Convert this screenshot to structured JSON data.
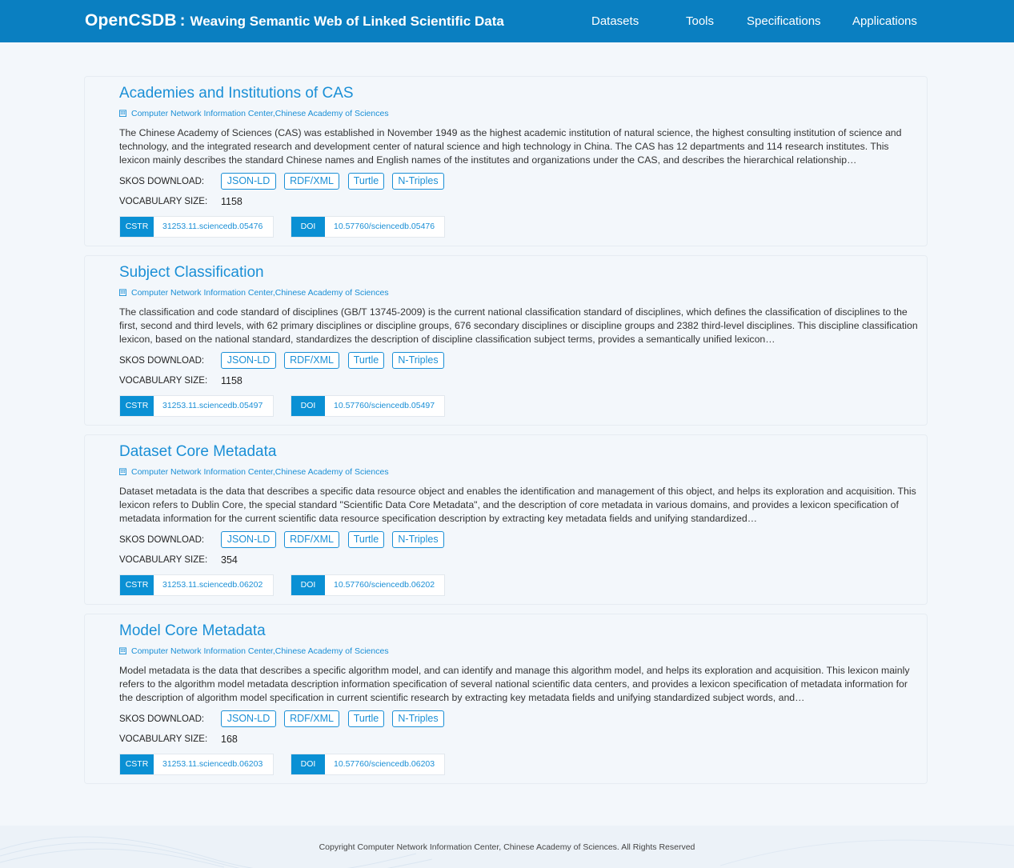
{
  "header": {
    "brand": "OpenCSDB",
    "colon": ":",
    "tagline": "Weaving Semantic Web of Linked Scientific Data",
    "nav": [
      "Datasets",
      "Tools",
      "Specifications",
      "Applications"
    ]
  },
  "labels": {
    "skos_download": "SKOS DOWNLOAD:",
    "vocabulary_size": "VOCABULARY SIZE:",
    "cstr": "CSTR",
    "doi": "DOI"
  },
  "download_formats": [
    "JSON-LD",
    "RDF/XML",
    "Turtle",
    "N-Triples"
  ],
  "cards": [
    {
      "title": "Academies and Institutions of CAS",
      "org": "Computer Network Information Center,Chinese Academy of Sciences",
      "description": "The Chinese Academy of Sciences (CAS) was established in November 1949 as the highest academic institution of natural science, the highest consulting institution of science and technology, and the integrated research and development center of natural science and high technology in China. The CAS has 12 departments and 114 research institutes. This lexicon mainly describes the standard Chinese names and English names of the institutes and organizations under the CAS, and describes the hierarchical relationship…",
      "vocabulary_size": "1158",
      "cstr": "31253.11.sciencedb.05476",
      "doi": "10.57760/sciencedb.05476"
    },
    {
      "title": "Subject Classification",
      "org": "Computer Network Information Center,Chinese Academy of Sciences",
      "description": "The classification and code standard of disciplines (GB/T 13745-2009) is the current national classification standard of disciplines, which defines the classification of disciplines to the first, second and third levels, with 62 primary disciplines or discipline groups, 676 secondary disciplines or discipline groups and 2382 third-level disciplines. This discipline classification lexicon, based on the national standard, standardizes the description of discipline classification subject terms, provides a semantically unified lexicon…",
      "vocabulary_size": "1158",
      "cstr": "31253.11.sciencedb.05497",
      "doi": "10.57760/sciencedb.05497"
    },
    {
      "title": "Dataset Core Metadata",
      "org": "Computer Network Information Center,Chinese Academy of Sciences",
      "description": "Dataset metadata is the data that describes a specific data resource object and enables the identification and management of this object, and helps its exploration and acquisition. This lexicon refers to Dublin Core, the special standard \"Scientific Data Core Metadata\", and the description of core metadata in various domains, and provides a lexicon specification of metadata information for the current scientific data resource specification description by extracting key metadata fields and unifying standardized…",
      "vocabulary_size": "354",
      "cstr": "31253.11.sciencedb.06202",
      "doi": "10.57760/sciencedb.06202"
    },
    {
      "title": "Model Core Metadata",
      "org": "Computer Network Information Center,Chinese Academy of Sciences",
      "description": "Model metadata is the data that describes a specific algorithm model, and can identify and manage this algorithm model, and helps its exploration and acquisition. This lexicon mainly refers to the algorithm model metadata description information specification of several national scientific data centers, and provides a lexicon specification of metadata information for the description of algorithm model specification in current scientific research by extracting key metadata fields and unifying standardized subject words, and…",
      "vocabulary_size": "168",
      "cstr": "31253.11.sciencedb.06203",
      "doi": "10.57760/sciencedb.06203"
    }
  ],
  "footer": {
    "copyright": "Copyright   Computer Network Information Center, Chinese Academy of Sciences. All Rights Reserved"
  },
  "colors": {
    "header_bg": "#0a7fc1",
    "accent": "#1a8fd6",
    "tag_bg": "#0a90d4",
    "page_bg": "#f3f7fb"
  }
}
